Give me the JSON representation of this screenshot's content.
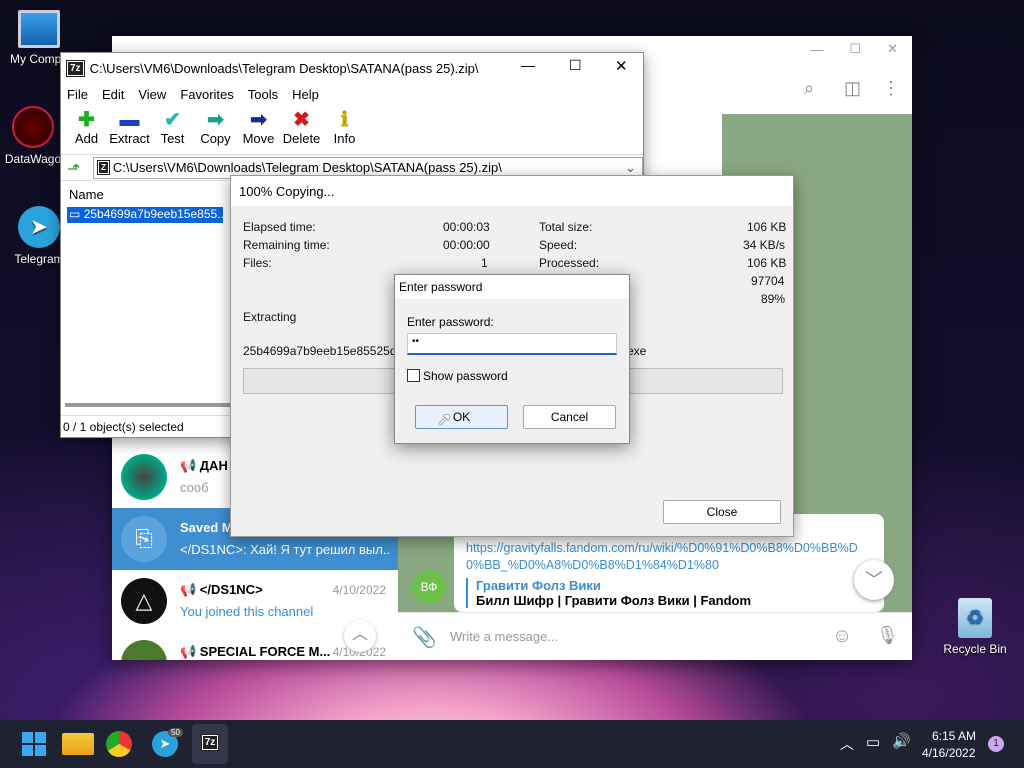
{
  "desktop": {
    "icons": [
      {
        "label": "My Compu"
      },
      {
        "label": "DataWago"
      },
      {
        "label": "Telegram"
      },
      {
        "label": "Recycle Bin"
      }
    ]
  },
  "telegram": {
    "chats": [
      {
        "name": "📢 ДАН",
        "preview": "сооб",
        "date": ""
      },
      {
        "name": "Saved M",
        "preview": "</DS1NC>: Хай! Я тут решил выл...",
        "date": ""
      },
      {
        "name": "📢 </DS1NC>",
        "preview": "You joined this channel",
        "date": "4/10/2022"
      },
      {
        "name": "📢 SPECIAL FORCE M...",
        "preview": "",
        "date": "4/10/2022"
      }
    ],
    "message_link": "https://gravityfalls.fandom.com/ru/wiki/%D0%91%D0%B8%D0%BB%D0%BB_%D0%A8%D0%B8%D1%84%D1%80",
    "link_title": "Гравити Фолз Вики",
    "link_desc": "Билл Шифр | Гравити Фолз Вики | Fandom",
    "avatar_initials": "ВФ",
    "input_placeholder": "Write a message..."
  },
  "sevenzip": {
    "title": "C:\\Users\\VM6\\Downloads\\Telegram Desktop\\SATANA(pass 25).zip\\",
    "menu": [
      "File",
      "Edit",
      "View",
      "Favorites",
      "Tools",
      "Help"
    ],
    "toolbar": [
      "Add",
      "Extract",
      "Test",
      "Copy",
      "Move",
      "Delete",
      "Info"
    ],
    "address": "C:\\Users\\VM6\\Downloads\\Telegram Desktop\\SATANA(pass 25).zip\\",
    "column_name": "Name",
    "file": "25b4699a7b9eeb15e855...",
    "status": "0 / 1 object(s) selected"
  },
  "progress": {
    "title": "100% Copying...",
    "elapsed_label": "Elapsed time:",
    "elapsed": "00:00:03",
    "remaining_label": "Remaining time:",
    "remaining": "00:00:00",
    "files_label": "Files:",
    "files": "1",
    "total_label": "Total size:",
    "total": "106 KB",
    "speed_label": "Speed:",
    "speed": "34 KB/s",
    "processed_label": "Processed:",
    "processed": "106 KB",
    "ratio_value": "97704",
    "percent_value": "89%",
    "extracting": "Extracting",
    "file_line": "25b4699a7b9eeb15e85525d843",
    "file_suffix": "exe",
    "close": "Close"
  },
  "password": {
    "title": "Enter password",
    "label": "Enter password:",
    "value": "••",
    "show": "Show password",
    "ok": "OK",
    "cancel": "Cancel"
  },
  "taskbar": {
    "time": "6:15 AM",
    "date": "4/16/2022",
    "telegram_badge": "50",
    "notif_count": "1"
  }
}
